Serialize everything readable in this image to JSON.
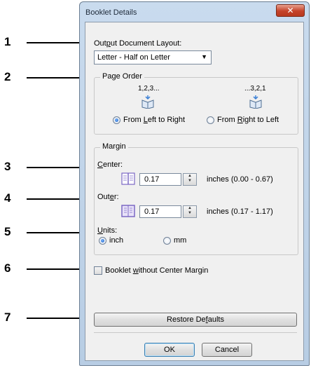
{
  "window": {
    "title": "Booklet Details",
    "close_glyph": "✕"
  },
  "callouts": [
    "1",
    "2",
    "3",
    "4",
    "5",
    "6",
    "7"
  ],
  "output_layout": {
    "label_pre": "Out",
    "label_u": "p",
    "label_post": "ut Document Layout:",
    "selected": "Letter - Half on Letter"
  },
  "page_order": {
    "legend": "Page Order",
    "ltr_sequence": "1,2,3...",
    "rtl_sequence": "...3,2,1",
    "ltr_pre": "From ",
    "ltr_u": "L",
    "ltr_post": "eft to Right",
    "rtl_pre": "From ",
    "rtl_u": "R",
    "rtl_post": "ight to Left",
    "selected": "From Left to Right"
  },
  "margin": {
    "legend": "Margin",
    "center_u": "C",
    "center_post": "enter:",
    "center_value": "0.17",
    "center_range": "inches (0.00 - 0.67)",
    "outer_pre": "Out",
    "outer_u": "e",
    "outer_post": "r:",
    "outer_value": "0.17",
    "outer_range": "inches (0.17 - 1.17)",
    "units_u": "U",
    "units_post": "nits:",
    "unit_inch": "inch",
    "unit_mm": "mm",
    "selected_unit": "inch"
  },
  "booklet_option": {
    "pre": "Booklet ",
    "u": "w",
    "post": "ithout Center Margin",
    "checked": false
  },
  "buttons": {
    "restore_pre": "Restore De",
    "restore_u": "f",
    "restore_post": "aults",
    "ok": "OK",
    "cancel": "Cancel"
  },
  "colors": {
    "book_icon": "#7b68c4",
    "book_accent": "#3a7fd5",
    "default_button_border": "#3c7fb1"
  },
  "icons": [
    "close-icon",
    "dropdown-arrow-icon",
    "booklet-ltr-icon",
    "booklet-rtl-icon",
    "book-center-icon",
    "book-outer-icon",
    "spin-arrows-icon"
  ]
}
